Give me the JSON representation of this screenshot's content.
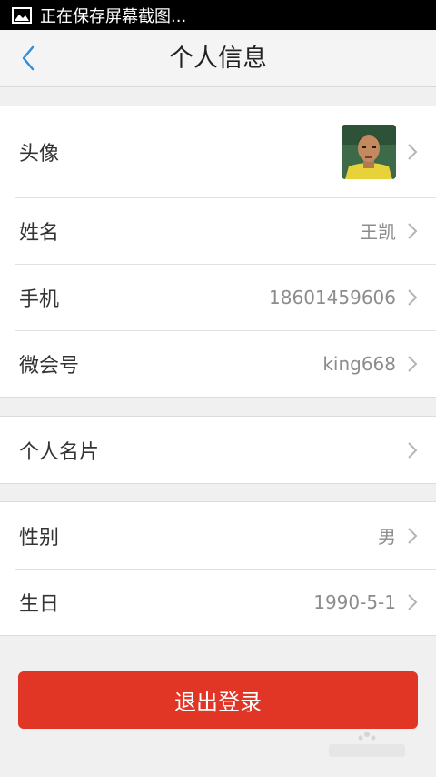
{
  "status_bar": {
    "notification_text": "正在保存屏幕截图...",
    "icon": "image-icon"
  },
  "nav": {
    "back_icon": "chevron-left-icon",
    "title": "个人信息"
  },
  "profile": {
    "avatar_label": "头像",
    "name_label": "姓名",
    "name_value": "王凯",
    "phone_label": "手机",
    "phone_value": "18601459606",
    "weihui_label": "微会号",
    "weihui_value": "king668"
  },
  "card": {
    "label": "个人名片"
  },
  "details": {
    "gender_label": "性别",
    "gender_value": "男",
    "birthday_label": "生日",
    "birthday_value": "1990-5-1"
  },
  "logout": {
    "label": "退出登录"
  },
  "colors": {
    "accent_blue": "#2f8fe0",
    "logout_red": "#e13526",
    "value_gray": "#8c8c8c"
  }
}
